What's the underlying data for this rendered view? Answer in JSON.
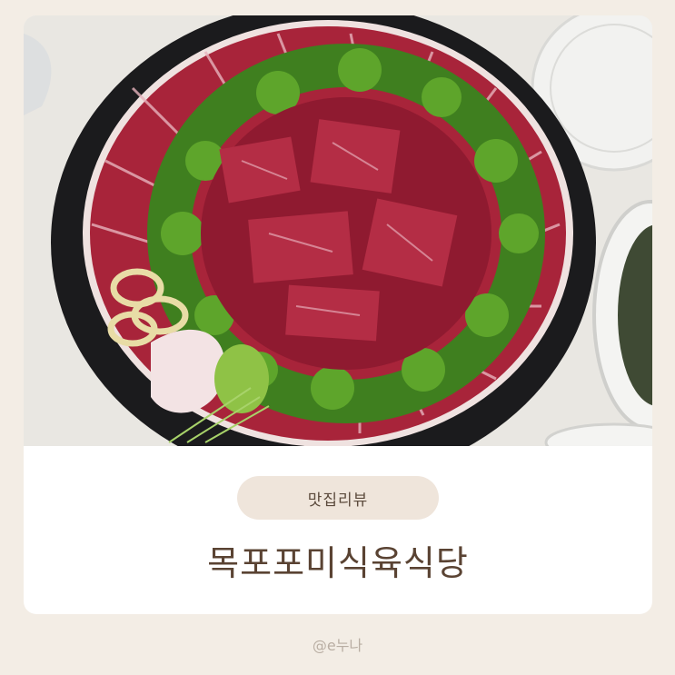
{
  "category_badge": "맛집리뷰",
  "title": "목포포미식육식당",
  "author_handle": "@e누나",
  "colors": {
    "page_background": "#f3ede5",
    "card_background": "#ffffff",
    "badge_background": "#efe5db",
    "title_text": "#5a4333",
    "handle_text": "#b9aea3"
  }
}
